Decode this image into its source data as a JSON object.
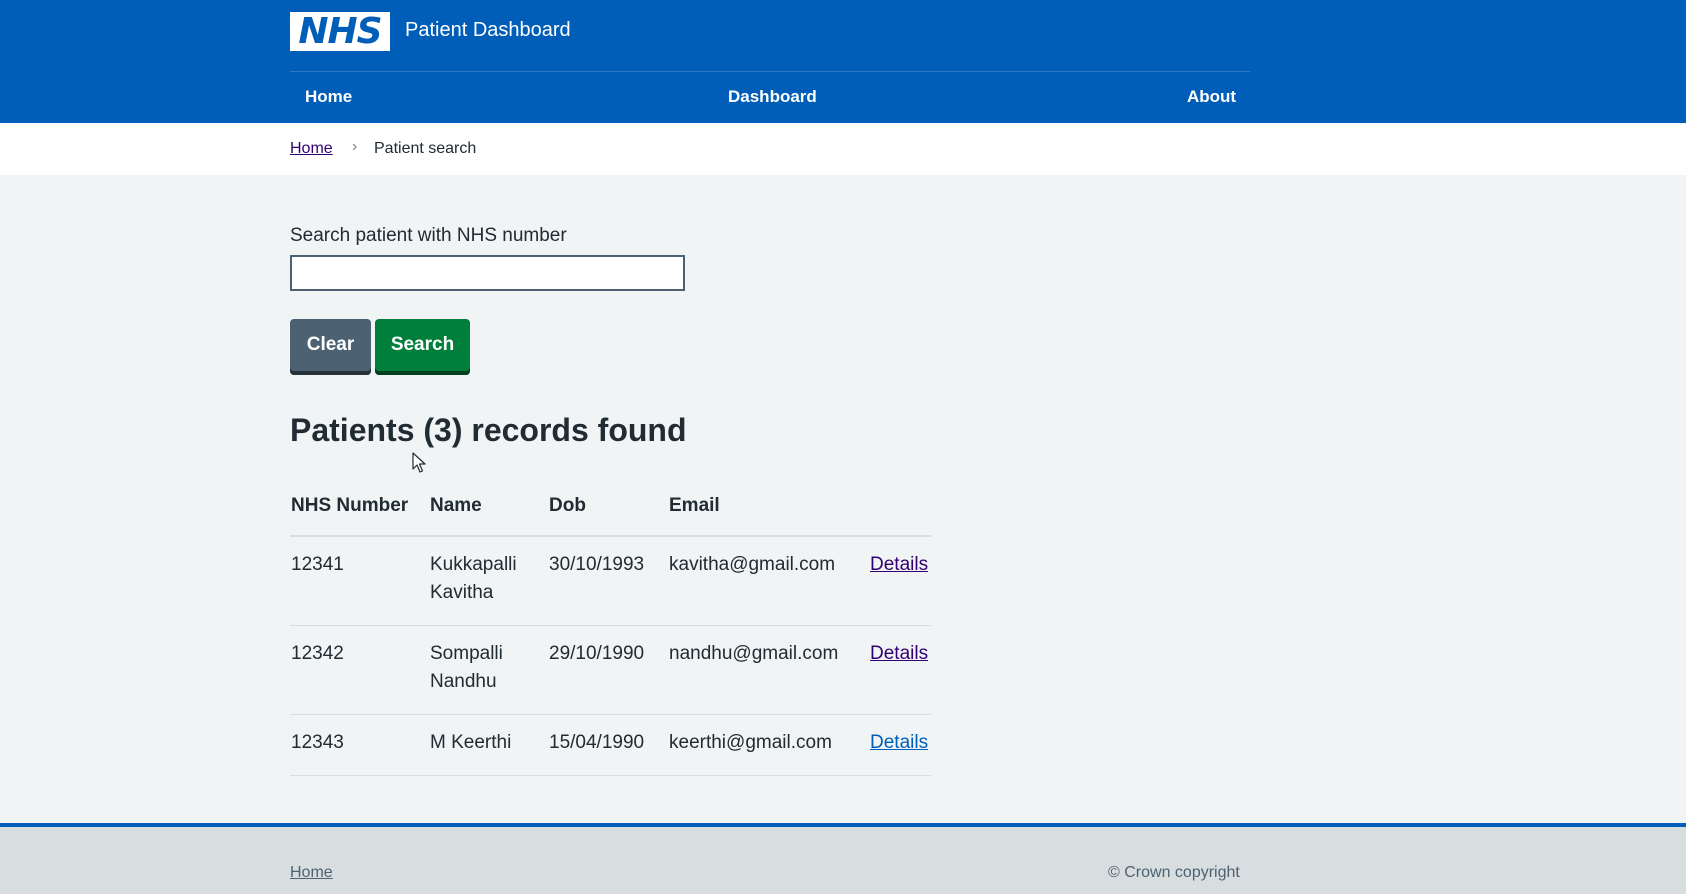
{
  "header": {
    "logo_text": "NHS",
    "service_name": "Patient Dashboard",
    "brand_color": "#005eb8",
    "nav": [
      {
        "label": "Home"
      },
      {
        "label": "Dashboard"
      },
      {
        "label": "About"
      }
    ]
  },
  "breadcrumb": {
    "home": "Home",
    "separator": "›",
    "current": "Patient search"
  },
  "search": {
    "label": "Search patient with NHS number",
    "value": "",
    "clear_label": "Clear",
    "search_label": "Search"
  },
  "results": {
    "heading": "Patients (3) records found",
    "columns": [
      "NHS Number",
      "Name",
      "Dob",
      "Email"
    ],
    "rows": [
      {
        "nhs": "12341",
        "name": "Kukkapalli Kavitha",
        "dob": "30/10/1993",
        "email": "kavitha@gmail.com",
        "link": "Details"
      },
      {
        "nhs": "12342",
        "name": "Sompalli Nandhu",
        "dob": "29/10/1990",
        "email": "nandhu@gmail.com",
        "link": "Details"
      },
      {
        "nhs": "12343",
        "name": "M Keerthi",
        "dob": "15/04/1990",
        "email": "keerthi@gmail.com",
        "link": "Details"
      }
    ]
  },
  "footer": {
    "home_link": "Home",
    "copyright": "© Crown copyright"
  },
  "colors": {
    "primary": "#005eb8",
    "success": "#007f3b",
    "secondary": "#4c6272",
    "link_visited": "#330072"
  }
}
